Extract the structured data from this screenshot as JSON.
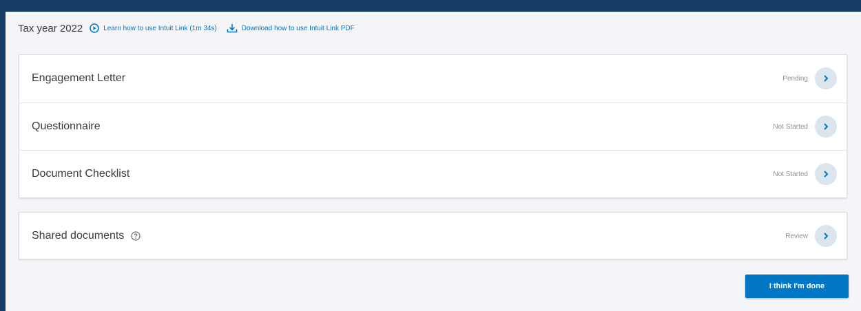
{
  "header": {
    "tax_year": "Tax year 2022",
    "video_link": "Learn how to use Intuit Link (1m 34s)",
    "pdf_link": "Download how to use Intuit Link PDF"
  },
  "tasks": [
    {
      "label": "Engagement Letter",
      "status": "Pending"
    },
    {
      "label": "Questionnaire",
      "status": "Not Started"
    },
    {
      "label": "Document Checklist",
      "status": "Not Started"
    }
  ],
  "shared": {
    "label": "Shared documents",
    "status": "Review"
  },
  "done_button": "I think I'm done",
  "colors": {
    "accent": "#0077c5",
    "background": "#143c64",
    "panel": "#f4f5f8"
  },
  "icons": {
    "video": "play-circle-icon",
    "download": "download-icon",
    "help": "question-circle-icon",
    "row": "chevron-right-icon"
  }
}
